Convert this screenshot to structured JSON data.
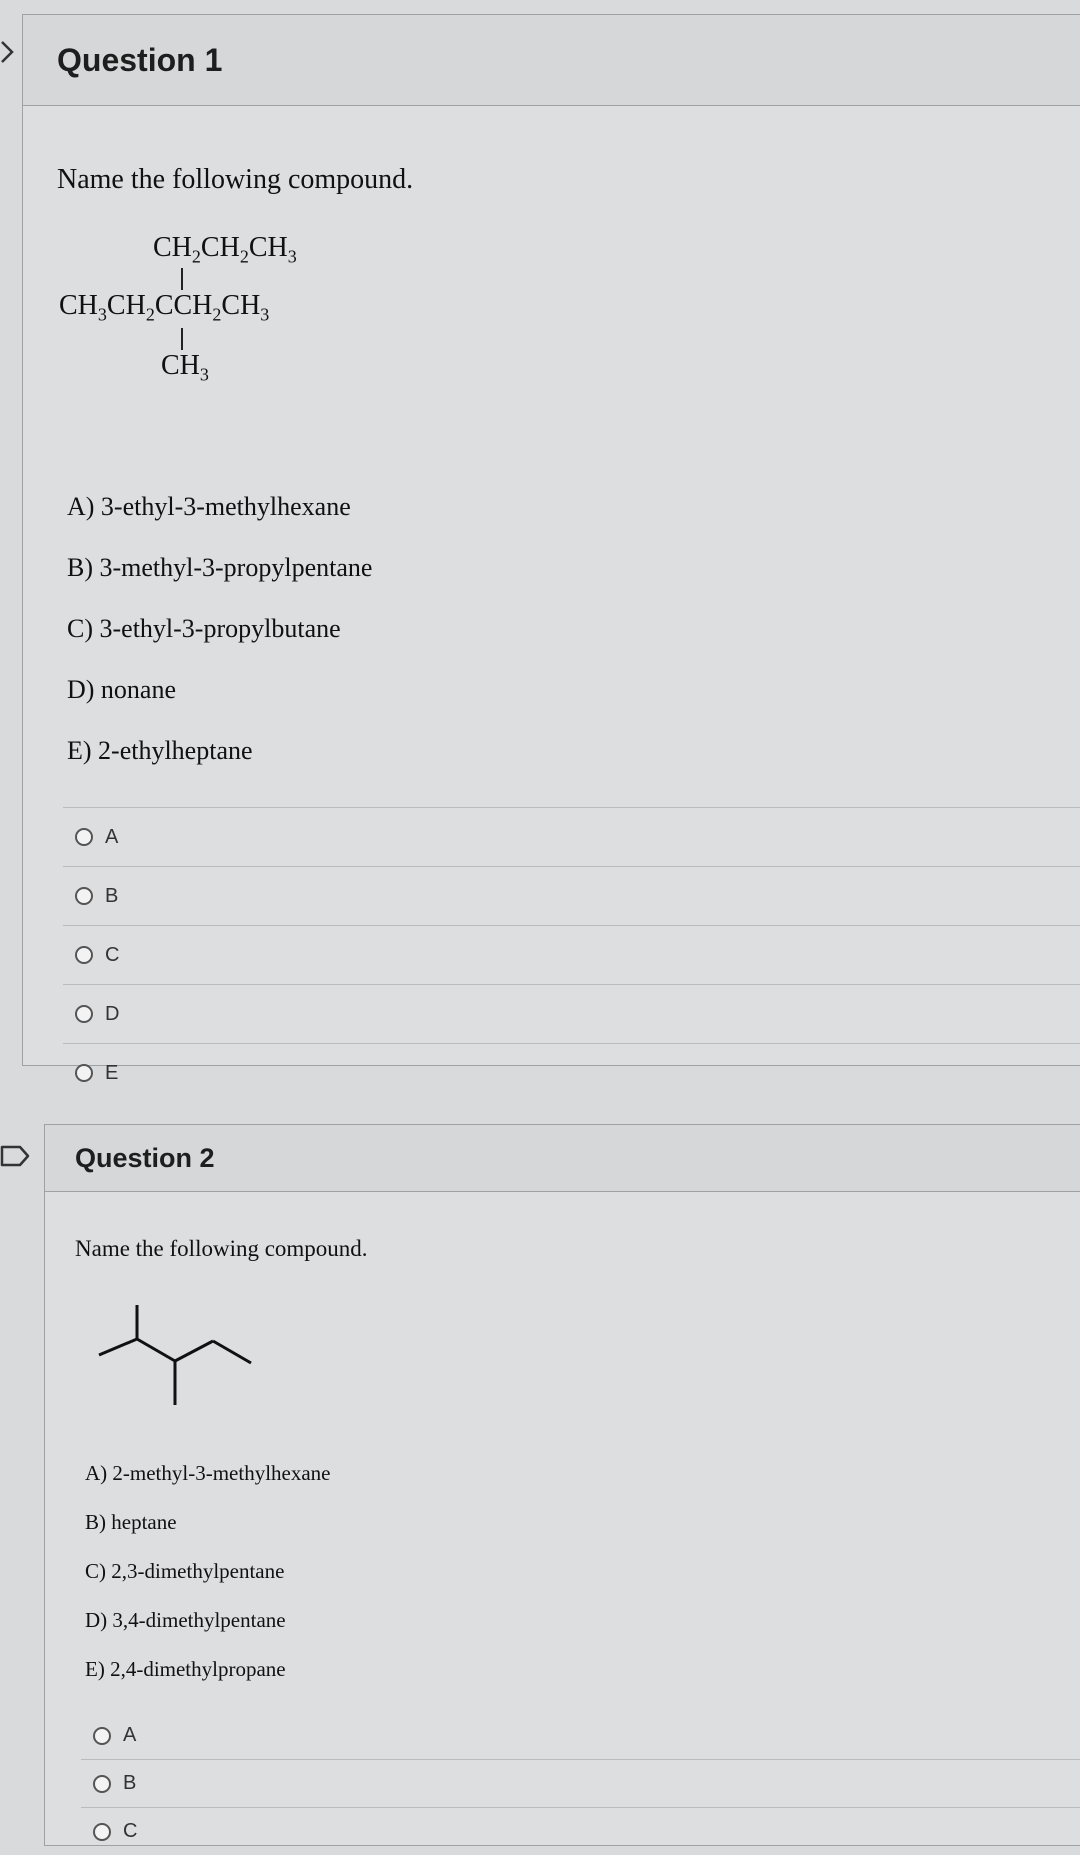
{
  "questions": [
    {
      "title": "Question 1",
      "prompt": "Name the following compound.",
      "formula": {
        "top": "CH2CH2CH3",
        "main": "CH3CH2CCH2CH3",
        "bottom": "CH3"
      },
      "choices": [
        "A) 3-ethyl-3-methylhexane",
        "B) 3-methyl-3-propylpentane",
        "C) 3-ethyl-3-propylbutane",
        "D) nonane",
        "E) 2-ethylheptane"
      ],
      "answers": [
        "A",
        "B",
        "C",
        "D",
        "E"
      ]
    },
    {
      "title": "Question 2",
      "prompt": "Name the following compound.",
      "choices": [
        "A) 2-methyl-3-methylhexane",
        "B) heptane",
        "C) 2,3-dimethylpentane",
        "D) 3,4-dimethylpentane",
        "E) 2,4-dimethylpropane"
      ],
      "answers": [
        "A",
        "B",
        "C"
      ]
    }
  ]
}
